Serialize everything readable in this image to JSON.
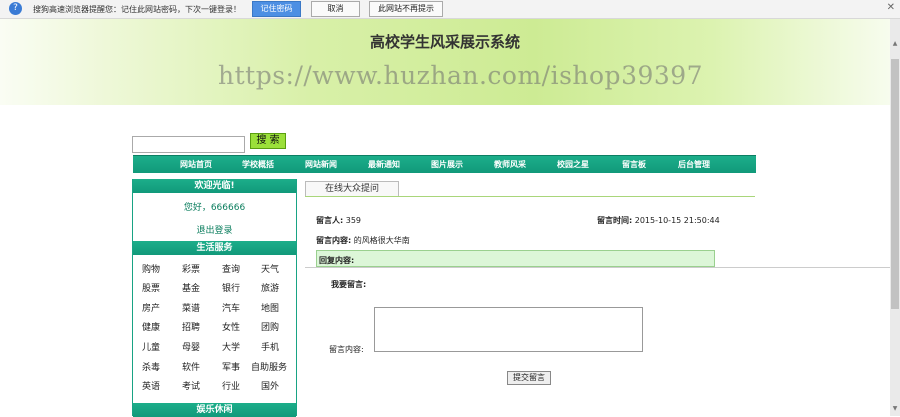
{
  "password_bar": {
    "message": "搜狗高速浏览器提醒您：记住此网站密码，下次一键登录！",
    "remember_label": "记住密码",
    "cancel_label": "取消",
    "never_label": "此网站不再提示",
    "close_glyph": "✕"
  },
  "banner": {
    "title": "高校学生风采展示系统",
    "watermark": "https://www.huzhan.com/ishop39397"
  },
  "search": {
    "button_label": "搜 索",
    "value": ""
  },
  "nav": {
    "items": [
      "网站首页",
      "学校概括",
      "网站新闻",
      "最新通知",
      "图片展示",
      "教师风采",
      "校园之星",
      "留言板",
      "后台管理"
    ]
  },
  "sidebar": {
    "welcome_title": "欢迎光临!",
    "greeting": "您好，666666",
    "logout": "退出登录",
    "services_title": "生活服务",
    "services": [
      [
        "购物",
        "彩票",
        "查询",
        "天气"
      ],
      [
        "股票",
        "基金",
        "银行",
        "旅游"
      ],
      [
        "房产",
        "菜谱",
        "汽车",
        "地图"
      ],
      [
        "健康",
        "招聘",
        "女性",
        "团购"
      ],
      [
        "儿童",
        "母婴",
        "大学",
        "手机"
      ],
      [
        "杀毒",
        "软件",
        "军事",
        "自助服务"
      ],
      [
        "英语",
        "考试",
        "行业",
        "国外"
      ]
    ],
    "leisure_title": "娱乐休闲"
  },
  "content": {
    "tab_label": "在线大众提问",
    "poster_label": "留言人:",
    "poster_value": "359",
    "time_label": "留言时间:",
    "time_value": "2015-10-15 21:50:44",
    "message_label": "留言内容:",
    "message_value": "的风格很大华南",
    "reply_label": "回复内容:",
    "leave_message_label": "我要留言:",
    "form_content_label": "留言内容:",
    "submit_label": "提交留言"
  },
  "colors": {
    "nav_green": "#11997a",
    "search_button": "#9be03a",
    "reply_bg": "#dcf6d8"
  }
}
